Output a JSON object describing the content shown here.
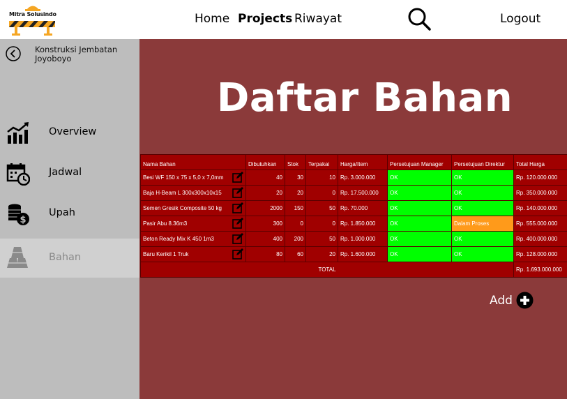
{
  "brand": {
    "name": "Mitra Solusindo"
  },
  "nav": {
    "home": "Home",
    "projects": "Projects",
    "riwayat": "Riwayat",
    "logout": "Logout"
  },
  "sidebar": {
    "project_name": "Konstruksi Jembatan Joyoboyo",
    "items": [
      {
        "label": "Overview",
        "icon": "chart-icon"
      },
      {
        "label": "Jadwal",
        "icon": "calendar-icon"
      },
      {
        "label": "Upah",
        "icon": "coins-icon"
      },
      {
        "label": "Bahan",
        "icon": "materials-icon",
        "active": true
      }
    ]
  },
  "main": {
    "title": "Daftar Bahan",
    "add_label": "Add"
  },
  "table": {
    "headers": [
      "Nama Bahan",
      "Dibutuhkan",
      "Stok",
      "Terpakai",
      "Harga/Item",
      "Persetujuan Manager",
      "Persetujuan Direktur",
      "Total Harga"
    ],
    "rows": [
      {
        "nama": "Besi WF 150 x 75 x 5,0 x 7,0mm",
        "dibutuhkan": "40",
        "stok": "30",
        "terpakai": "10",
        "harga": "Rp. 3.000.000",
        "manager": "OK",
        "direktur": "OK",
        "total": "Rp. 120.000.000"
      },
      {
        "nama": "Baja H-Beam L 300x300x10x15",
        "dibutuhkan": "20",
        "stok": "20",
        "terpakai": "0",
        "harga": "Rp. 17.500.000",
        "manager": "OK",
        "direktur": "OK",
        "total": "Rp. 350.000.000"
      },
      {
        "nama": "Semen Gresik Composite 50 kg",
        "dibutuhkan": "2000",
        "stok": "150",
        "terpakai": "50",
        "harga": "Rp. 70.000",
        "manager": "OK",
        "direktur": "OK",
        "total": "Rp. 140.000.000"
      },
      {
        "nama": "Pasir Abu 8.36m3",
        "dibutuhkan": "300",
        "stok": "0",
        "terpakai": "0",
        "harga": "Rp. 1.850.000",
        "manager": "OK",
        "direktur": "Dalam Proses",
        "total": "Rp. 555.000.000"
      },
      {
        "nama": "Beton Ready Mix K 450 1m3",
        "dibutuhkan": "400",
        "stok": "200",
        "terpakai": "50",
        "harga": "Rp. 1.000.000",
        "manager": "OK",
        "direktur": "OK",
        "total": "Rp. 400.000.000"
      },
      {
        "nama": "Baru Kerikil 1 Truk",
        "dibutuhkan": "80",
        "stok": "60",
        "terpakai": "20",
        "harga": "Rp. 1.600.000",
        "manager": "OK",
        "direktur": "OK",
        "total": "Rp. 128.000.000"
      }
    ],
    "total_label": "TOTAL",
    "total_value": "Rp. 1.693.000.000"
  },
  "colors": {
    "main_bg": "#8b3a3a",
    "table_cell": "#a00000",
    "approved": "#00ff00",
    "in_process": "#ff9a1a",
    "sidebar_bg": "#bdbdbd"
  }
}
